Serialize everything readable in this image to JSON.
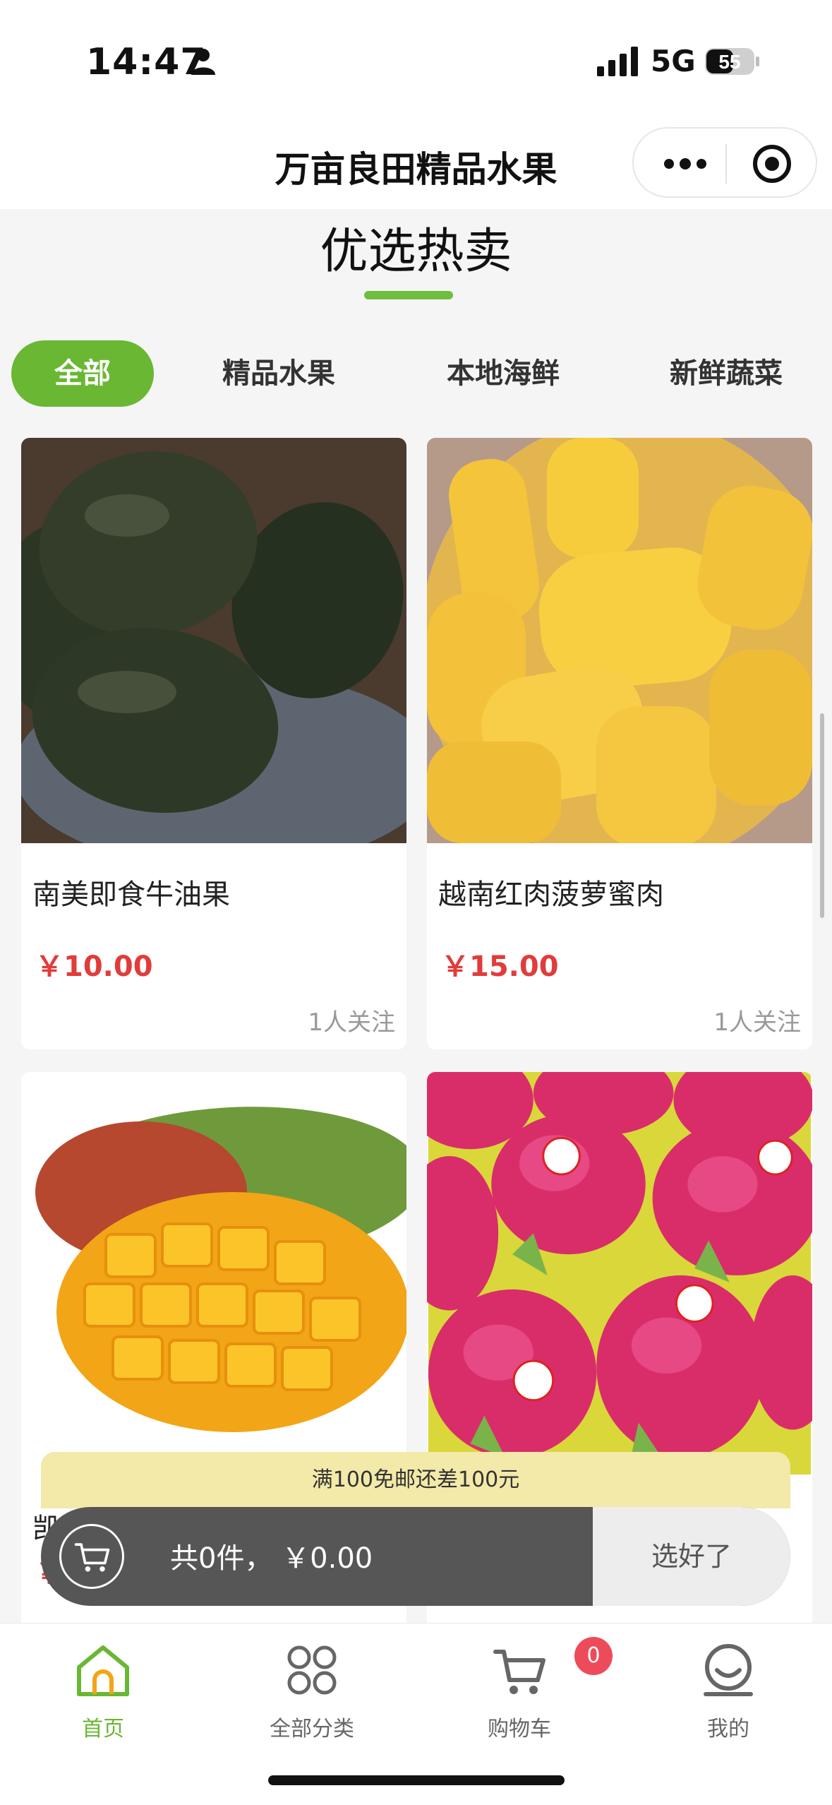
{
  "status_bar": {
    "time": "14:47",
    "network": "5G",
    "battery": "55"
  },
  "nav": {
    "title": "万亩良田精品水果"
  },
  "section": {
    "title": "优选热卖"
  },
  "tabs": [
    {
      "label": "全部",
      "active": true
    },
    {
      "label": "精品水果",
      "active": false
    },
    {
      "label": "本地海鲜",
      "active": false
    },
    {
      "label": "新鲜蔬菜",
      "active": false
    }
  ],
  "products": [
    {
      "name": "南美即食牛油果",
      "price": "￥10.00",
      "follow": "1人关注",
      "image": "avocado"
    },
    {
      "name": "越南红肉菠萝蜜肉",
      "price": "￥15.00",
      "follow": "1人关注",
      "image": "jackfruit"
    },
    {
      "name": "凯",
      "price": "￥",
      "follow": "",
      "image": "mango"
    },
    {
      "name": "",
      "price": "",
      "follow": "",
      "image": "dragon-fruit"
    }
  ],
  "cart": {
    "shipping_notice": "满100免邮还差100元",
    "summary": "共0件， ￥0.00",
    "done_label": "选好了"
  },
  "tabbar": [
    {
      "label": "首页",
      "icon": "home-icon",
      "active": true
    },
    {
      "label": "全部分类",
      "icon": "category-icon",
      "active": false
    },
    {
      "label": "购物车",
      "icon": "cart-icon",
      "active": false,
      "badge": "0"
    },
    {
      "label": "我的",
      "icon": "profile-icon",
      "active": false
    }
  ],
  "colors": {
    "accent": "#69b733",
    "price": "#e23b3b",
    "cart_bar": "#565656",
    "banner": "#f3e9a8",
    "badge": "#ee4b5a"
  }
}
